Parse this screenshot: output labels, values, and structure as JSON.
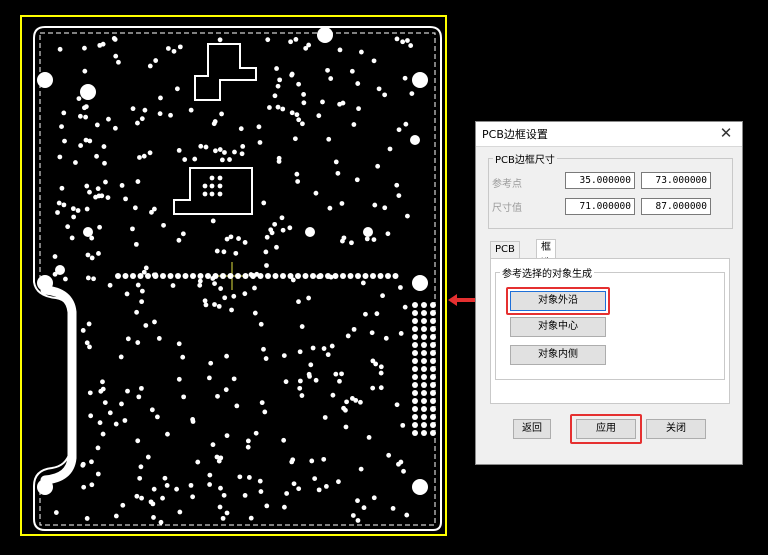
{
  "dialog": {
    "title": "PCB边框设置",
    "close_icon": "close-icon",
    "size_group": {
      "legend": "PCB边框尺寸",
      "ref_label": "参考点",
      "ref_x": "35.000000",
      "ref_y": "73.000000",
      "size_label": "尺寸值",
      "size_w": "71.000000",
      "size_h": "87.000000"
    },
    "tabs": [
      {
        "label": "PCB设置",
        "active": false
      },
      {
        "label": "框选设置",
        "active": true
      }
    ],
    "select_group": {
      "legend": "参考选择的对象生成",
      "buttons": [
        "对象外沿",
        "对象中心",
        "对象内侧"
      ]
    },
    "footer": {
      "back": "返回",
      "apply": "应用",
      "close": "关闭"
    }
  },
  "colors": {
    "highlight": "#e53030",
    "focus": "#1e6fd8",
    "board_outline": "#ffff00"
  }
}
